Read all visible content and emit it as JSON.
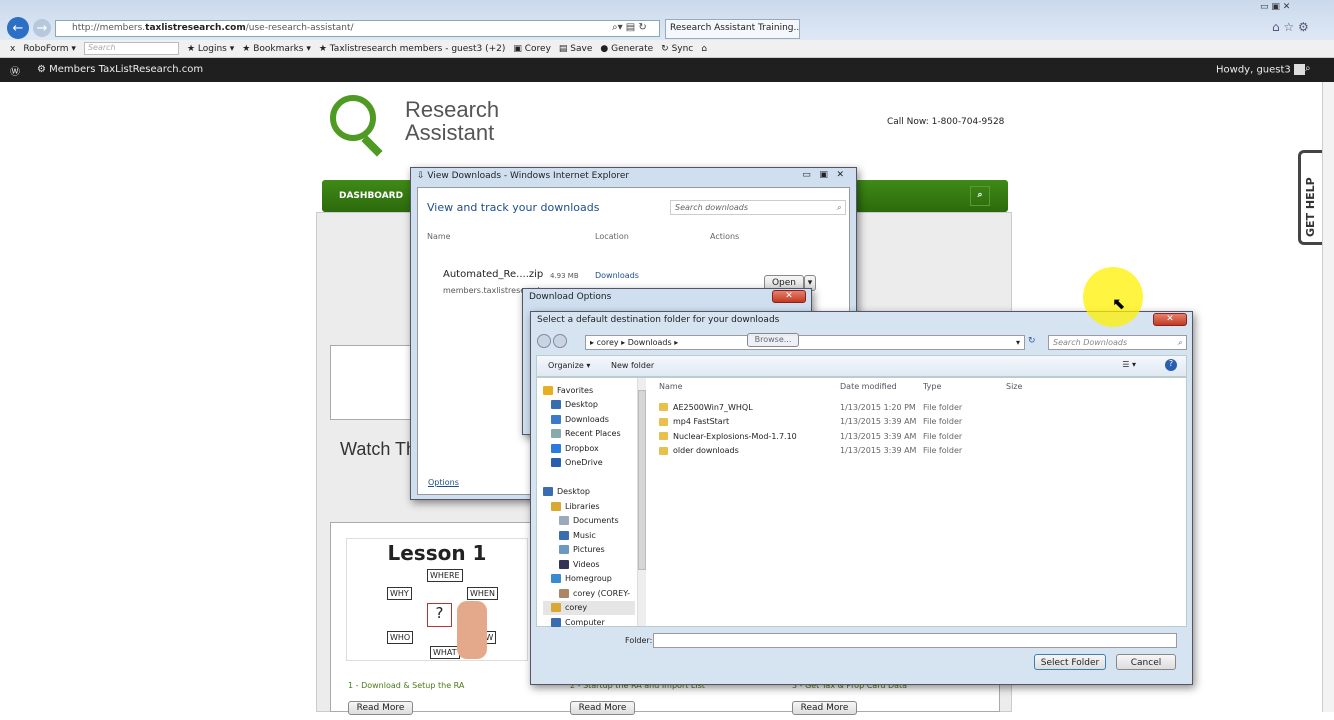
{
  "browser": {
    "url_prefix": "http://members.",
    "url_domain": "taxlistresearch.com",
    "url_path": "/use-research-assistant/",
    "tab_title": "Research Assistant Training..."
  },
  "toolbar": {
    "close": "x",
    "roboform": "RoboForm ▾",
    "search_placeholder": "Search",
    "logins": "Logins ▾",
    "bookmarks": "Bookmarks ▾",
    "site": "Taxlistresearch members - guest3 (+2)",
    "corey": "Corey",
    "save": "Save",
    "generate": "Generate",
    "sync": "Sync"
  },
  "wpbar": {
    "site": "Members TaxListResearch.com",
    "greeting": "Howdy, guest3"
  },
  "site": {
    "logo_line1": "Research",
    "logo_line2": "Assistant",
    "call": "Call Now: 1-800-704-9528",
    "nav_dashboard": "DASHBOARD",
    "watch": "Watch The",
    "get_help": "GET HELP",
    "lesson_title": "Lesson 1",
    "lesson_words": [
      "WHERE",
      "WHY",
      "WHEN",
      "WHO",
      "HOW",
      "WHAT",
      "?"
    ],
    "captions": [
      "1 - Download & Setup the RA",
      "2 - Startup the RA and Import List",
      "3 - Get Tax & Prop Card Data"
    ],
    "read_more": "Read More"
  },
  "downloads": {
    "title": "View Downloads - Windows Internet Explorer",
    "heading": "View and track your downloads",
    "search_placeholder": "Search downloads",
    "col_name": "Name",
    "col_location": "Location",
    "col_actions": "Actions",
    "file": "Automated_Re....zip",
    "size": "4.93 MB",
    "location": "Downloads",
    "source": "members.taxlistresearch",
    "open": "Open",
    "options": "Options"
  },
  "options_dialog": {
    "title": "Download Options",
    "browse": "Browse..."
  },
  "folder_dialog": {
    "title": "Select a default destination folder for your downloads",
    "breadcrumb": [
      "corey",
      "Downloads"
    ],
    "search_placeholder": "Search Downloads",
    "organize": "Organize ▾",
    "new_folder": "New folder",
    "nav": [
      {
        "label": "Favorites",
        "indent": 0,
        "color": "#e8b020"
      },
      {
        "label": "Desktop",
        "indent": 1,
        "color": "#3a6db0"
      },
      {
        "label": "Downloads",
        "indent": 1,
        "color": "#3a7ac8"
      },
      {
        "label": "Recent Places",
        "indent": 1,
        "color": "#8aa"
      },
      {
        "label": "Dropbox",
        "indent": 1,
        "color": "#2a7ae0"
      },
      {
        "label": "OneDrive",
        "indent": 1,
        "color": "#2a5fb0"
      },
      {
        "label": "",
        "indent": 0,
        "color": ""
      },
      {
        "label": "Desktop",
        "indent": 0,
        "color": "#3a6db0"
      },
      {
        "label": "Libraries",
        "indent": 1,
        "color": "#d9a733"
      },
      {
        "label": "Documents",
        "indent": 2,
        "color": "#9ab"
      },
      {
        "label": "Music",
        "indent": 2,
        "color": "#3a6db0"
      },
      {
        "label": "Pictures",
        "indent": 2,
        "color": "#6a9ac0"
      },
      {
        "label": "Videos",
        "indent": 2,
        "color": "#335"
      },
      {
        "label": "Homegroup",
        "indent": 1,
        "color": "#3a8ad0"
      },
      {
        "label": "corey (COREY-",
        "indent": 2,
        "color": "#a86"
      },
      {
        "label": "corey",
        "indent": 1,
        "color": "#d9a733"
      },
      {
        "label": "Computer",
        "indent": 1,
        "color": "#3a6db0"
      }
    ],
    "columns": [
      "Name",
      "Date modified",
      "Type",
      "Size"
    ],
    "files": [
      {
        "name": "AE2500Win7_WHQL",
        "date": "1/13/2015 1:20 PM",
        "type": "File folder"
      },
      {
        "name": "mp4 FastStart",
        "date": "1/13/2015 3:39 AM",
        "type": "File folder"
      },
      {
        "name": "Nuclear-Explosions-Mod-1.7.10",
        "date": "1/13/2015 3:39 AM",
        "type": "File folder"
      },
      {
        "name": "older downloads",
        "date": "1/13/2015 3:39 AM",
        "type": "File folder"
      }
    ],
    "folder_label": "Folder:",
    "folder_value": "",
    "select": "Select Folder",
    "cancel": "Cancel"
  }
}
